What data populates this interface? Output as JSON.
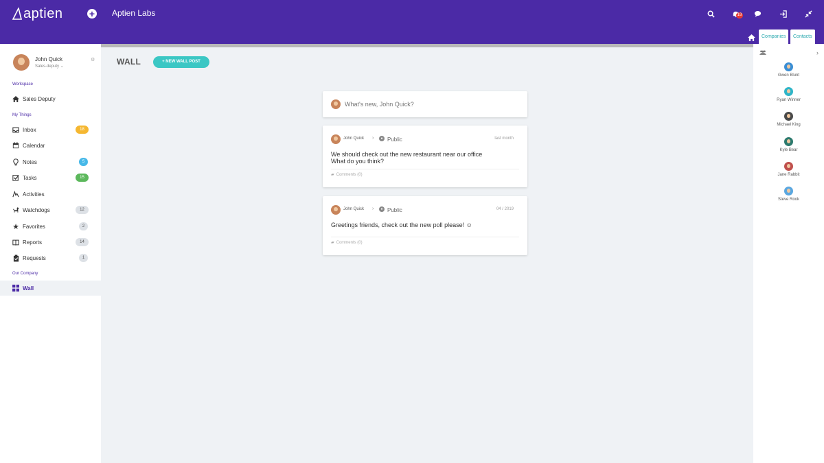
{
  "header": {
    "logo_text": "aptien",
    "org_name": "Aptien Labs",
    "notification_count": "18",
    "tabs": [
      "Companies",
      "Contacts"
    ]
  },
  "sidebar": {
    "user_name": "John Quick",
    "user_role": "Sales-deputy",
    "sections": {
      "workspace": "Workspace",
      "my_things": "My Things",
      "our_company": "Our Company"
    },
    "items": [
      {
        "label": "Sales Deputy",
        "icon": "home-icon"
      },
      {
        "label": "Inbox",
        "icon": "inbox-icon",
        "badge": "18"
      },
      {
        "label": "Calendar",
        "icon": "calendar-icon"
      },
      {
        "label": "Notes",
        "icon": "lightbulb-icon",
        "badge": "5"
      },
      {
        "label": "Tasks",
        "icon": "check-square-icon",
        "badge": "15"
      },
      {
        "label": "Activities",
        "icon": "activity-icon"
      },
      {
        "label": "Watchdogs",
        "icon": "dog-icon",
        "badge": "12"
      },
      {
        "label": "Favorites",
        "icon": "star-icon",
        "badge": "2"
      },
      {
        "label": "Reports",
        "icon": "book-icon",
        "badge": "14"
      },
      {
        "label": "Requests",
        "icon": "clipboard-icon",
        "badge": "1"
      },
      {
        "label": "Wall",
        "icon": "grid-icon"
      }
    ],
    "colors": {
      "inbox": "#f5b731",
      "notes": "#46b8e8",
      "tasks": "#5cb85c",
      "grey": "#dde1e6"
    }
  },
  "main": {
    "title": "WALL",
    "new_post_label": "+ NEW WALL POST",
    "compose_placeholder": "What's new, John Quick?",
    "posts": [
      {
        "author": "John Quick",
        "visibility": "Public",
        "time": "last month",
        "body_line1": "We should check out the new restaurant near our office",
        "body_line2": "What do you think?",
        "comments": "Comments (0)"
      },
      {
        "author": "John Quick",
        "visibility": "Public",
        "time": "04 / 2019",
        "body_line1": "Greetings friends, check out the new poll please! ☺",
        "comments": "Comments (0)"
      }
    ]
  },
  "rightbar": {
    "contacts": [
      "Gwen Blunt",
      "Ryan Winner",
      "Michael King",
      "Kyle Bear",
      "Jane Rabbit",
      "Steve Rook"
    ]
  },
  "accent": "#4b2aa6"
}
